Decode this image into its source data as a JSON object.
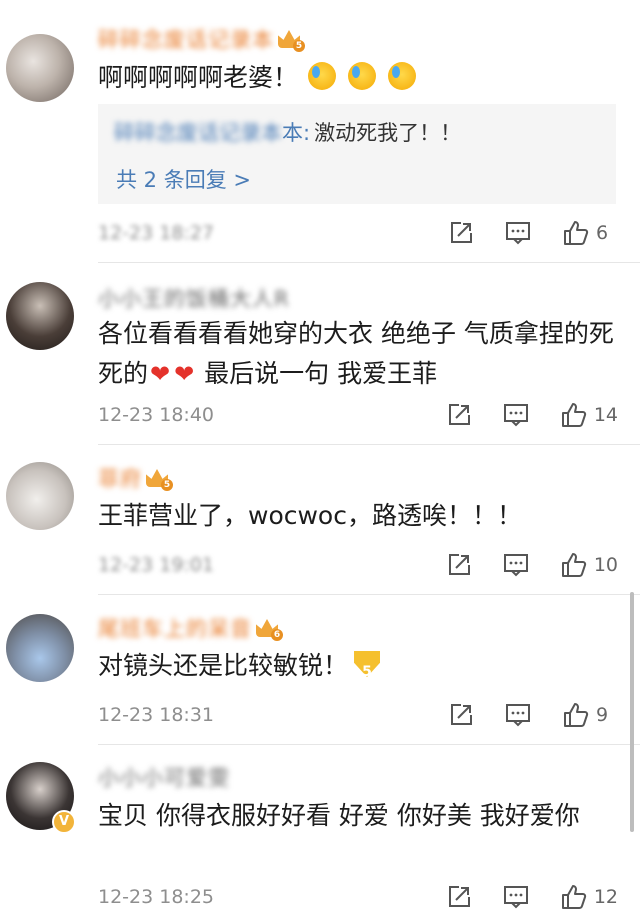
{
  "comments": [
    {
      "name": "碎碎念废话记录本",
      "text": "啊啊啊啊啊老婆！",
      "emoji_names": [
        "crying-face-icon",
        "crying-face-icon",
        "crying-face-icon"
      ],
      "reply": {
        "author": "碎碎念废话记录本",
        "sep": "本:",
        "text": "激动死我了！！",
        "more": "共 2 条回复 >"
      },
      "time": "12-23 18:27",
      "like_count": "6"
    },
    {
      "name": "小小王的饭桶大人R",
      "name_tail": "R",
      "text": "各位看看看看她穿的大衣 绝绝子  气质拿捏的死死的",
      "text_tail": " 最后说一句 我爱王菲",
      "time": "12-23 18:40",
      "like_count": "14"
    },
    {
      "name": "菲府",
      "crown_level": "5",
      "text": "王菲营业了，wocwoc，路透唉！！！",
      "time": "12-23 19:01",
      "like_count": "10"
    },
    {
      "name": "尾班车上的呆音",
      "crown_level": "6",
      "text": "对镜头还是比较敏锐！",
      "badge_num": "5",
      "time": "12-23 18:31",
      "like_count": "9"
    },
    {
      "name": "小小小可爱雯",
      "name_tail": "雯",
      "verified": "V",
      "text": "宝贝 你得衣服好好看 好爱 你好美 我好爱你",
      "time": "12-23 18:25",
      "like_count": "12"
    }
  ],
  "colors": {
    "name_orange": "#e87b2a",
    "link_blue": "#4a7cb6",
    "timestamp_grey": "#8e8e8e",
    "heart_red": "#e4322b"
  },
  "icons": [
    "share-icon",
    "comment-icon",
    "like-icon"
  ]
}
